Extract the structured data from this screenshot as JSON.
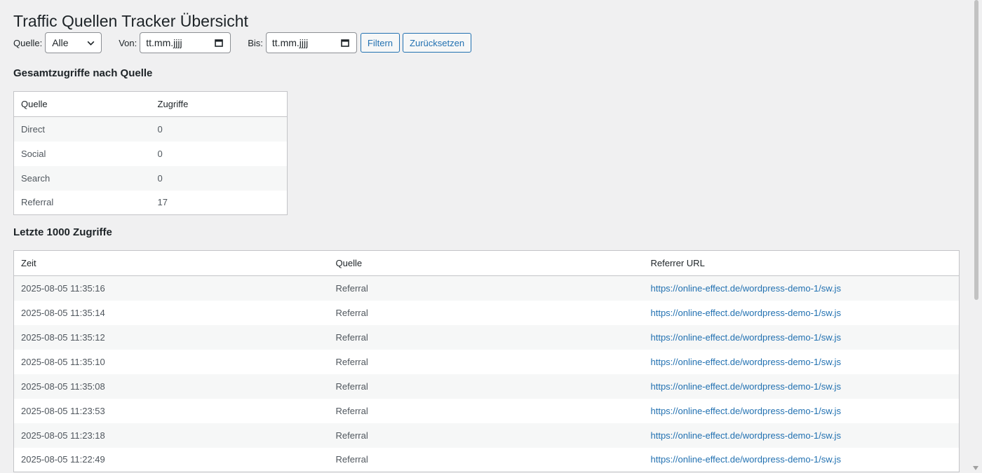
{
  "page": {
    "title": "Traffic Quellen Tracker Übersicht"
  },
  "filters": {
    "source_label": "Quelle:",
    "source_value": "Alle",
    "from_label": "Von:",
    "from_placeholder": "tt.mm.jjjj",
    "to_label": "Bis:",
    "to_placeholder": "tt.mm.jjjj",
    "filter_button": "Filtern",
    "reset_button": "Zurücksetzen"
  },
  "summary": {
    "heading": "Gesamtzugriffe nach Quelle",
    "columns": [
      "Quelle",
      "Zugriffe"
    ],
    "rows": [
      {
        "source": "Direct",
        "count": "0"
      },
      {
        "source": "Social",
        "count": "0"
      },
      {
        "source": "Search",
        "count": "0"
      },
      {
        "source": "Referral",
        "count": "17"
      }
    ]
  },
  "recent": {
    "heading": "Letzte 1000 Zugriffe",
    "columns": [
      "Zeit",
      "Quelle",
      "Referrer URL"
    ],
    "rows": [
      {
        "time": "2025-08-05 11:35:16",
        "source": "Referral",
        "url": "https://online-effect.de/wordpress-demo-1/sw.js"
      },
      {
        "time": "2025-08-05 11:35:14",
        "source": "Referral",
        "url": "https://online-effect.de/wordpress-demo-1/sw.js"
      },
      {
        "time": "2025-08-05 11:35:12",
        "source": "Referral",
        "url": "https://online-effect.de/wordpress-demo-1/sw.js"
      },
      {
        "time": "2025-08-05 11:35:10",
        "source": "Referral",
        "url": "https://online-effect.de/wordpress-demo-1/sw.js"
      },
      {
        "time": "2025-08-05 11:35:08",
        "source": "Referral",
        "url": "https://online-effect.de/wordpress-demo-1/sw.js"
      },
      {
        "time": "2025-08-05 11:23:53",
        "source": "Referral",
        "url": "https://online-effect.de/wordpress-demo-1/sw.js"
      },
      {
        "time": "2025-08-05 11:23:18",
        "source": "Referral",
        "url": "https://online-effect.de/wordpress-demo-1/sw.js"
      },
      {
        "time": "2025-08-05 11:22:49",
        "source": "Referral",
        "url": "https://online-effect.de/wordpress-demo-1/sw.js"
      }
    ]
  },
  "icons": {
    "select": "chevron-down-icon",
    "date": "calendar-icon"
  },
  "colors": {
    "accent": "#2271b1",
    "background": "#f0f0f1"
  }
}
